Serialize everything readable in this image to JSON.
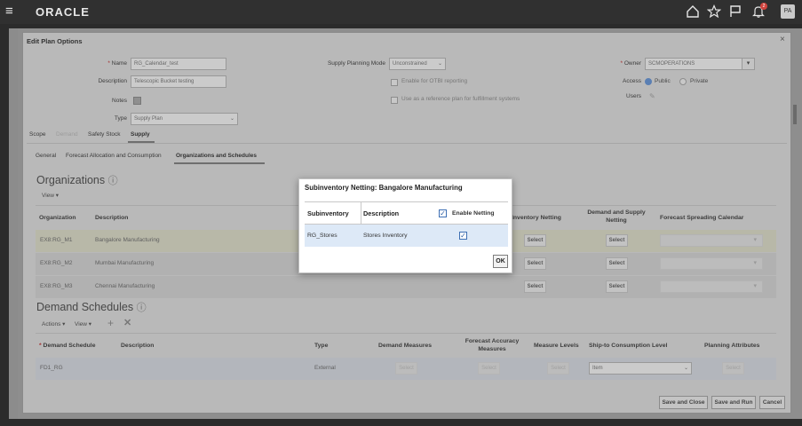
{
  "topbar": {
    "logo": "ORACLE",
    "notification_count": "2",
    "user_initials": "PA"
  },
  "dialog": {
    "title": "Edit Plan Options",
    "close": "×",
    "form": {
      "name_label": "Name",
      "name_value": "RG_Calendar_test",
      "description_label": "Description",
      "description_value": "Telescopic Bucket testing",
      "notes_label": "Notes",
      "type_label": "Type",
      "type_value": "Supply Plan",
      "supply_mode_label": "Supply Planning Mode",
      "supply_mode_value": "Unconstrained",
      "otbi_label": "Enable for OTBI reporting",
      "reference_label": "Use as a reference plan for fulfillment systems",
      "owner_label": "Owner",
      "owner_value": "SCMOPERATIONS",
      "access_label": "Access",
      "access_public": "Public",
      "access_private": "Private",
      "users_label": "Users"
    },
    "tabs": [
      "Scope",
      "Demand",
      "Safety Stock",
      "Supply"
    ],
    "subtabs": [
      "General",
      "Forecast Allocation and Consumption",
      "Organizations and Schedules"
    ],
    "organizations": {
      "title": "Organizations",
      "view_label": "View",
      "headers": [
        "Organization",
        "Description",
        "Inventory Netting",
        "Demand and Supply Netting",
        "Forecast Spreading Calendar"
      ],
      "inventory_netting_prefix": "S",
      "select_label": "Select",
      "rows": [
        {
          "org": "EX8:RG_M1",
          "desc": "Bangalore Manufacturing"
        },
        {
          "org": "EX8:RG_M2",
          "desc": "Mumbai Manufacturing"
        },
        {
          "org": "EX8:RG_M3",
          "desc": "Chennai Manufacturing"
        }
      ]
    },
    "demand_schedules": {
      "title": "Demand Schedules",
      "actions_label": "Actions",
      "view_label": "View",
      "headers": [
        "Demand Schedule",
        "Description",
        "Type",
        "Demand Measures",
        "Forecast Accuracy Measures",
        "Measure Levels",
        "Ship-to Consumption Level",
        "Planning Attributes"
      ],
      "rows": [
        {
          "schedule": "FD1_RG",
          "description": "",
          "type": "External",
          "demand_measures": "Select",
          "forecast_accuracy": "Select",
          "measure_levels": "Select",
          "ship_to_level": "Item",
          "planning_attributes": "Select"
        }
      ]
    },
    "footer": {
      "save_close": "Save and Close",
      "save_run": "Save and Run",
      "cancel": "Cancel"
    }
  },
  "modal": {
    "title": "Subinventory Netting: Bangalore Manufacturing",
    "headers": [
      "Subinventory",
      "Description",
      "Enable Netting"
    ],
    "rows": [
      {
        "subinventory": "RG_Stores",
        "description": "Stores Inventory",
        "enable_netting": true
      }
    ],
    "ok_label": "OK"
  },
  "colors": {
    "topbar": "#303030",
    "overlay": "#b9b9b9",
    "modal_row_highlight": "#dde9f7",
    "check_blue": "#2a5da3"
  }
}
